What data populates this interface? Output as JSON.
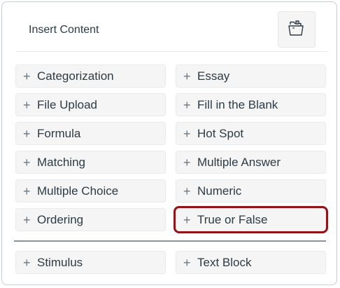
{
  "header": {
    "title": "Insert Content",
    "folder_icon": "folder-open-icon"
  },
  "content_types": [
    {
      "label": "Categorization",
      "highlighted": false
    },
    {
      "label": "Essay",
      "highlighted": false
    },
    {
      "label": "File Upload",
      "highlighted": false
    },
    {
      "label": "Fill in the Blank",
      "highlighted": false
    },
    {
      "label": "Formula",
      "highlighted": false
    },
    {
      "label": "Hot Spot",
      "highlighted": false
    },
    {
      "label": "Matching",
      "highlighted": false
    },
    {
      "label": "Multiple Answer",
      "highlighted": false
    },
    {
      "label": "Multiple Choice",
      "highlighted": false
    },
    {
      "label": "Numeric",
      "highlighted": false
    },
    {
      "label": "Ordering",
      "highlighted": false
    },
    {
      "label": "True or False",
      "highlighted": true
    }
  ],
  "extra_types": [
    {
      "label": "Stimulus"
    },
    {
      "label": "Text Block"
    }
  ],
  "plus_symbol": "+",
  "colors": {
    "highlight": "#8e1519",
    "text": "#2d3b45",
    "button_bg": "#f5f5f5"
  }
}
